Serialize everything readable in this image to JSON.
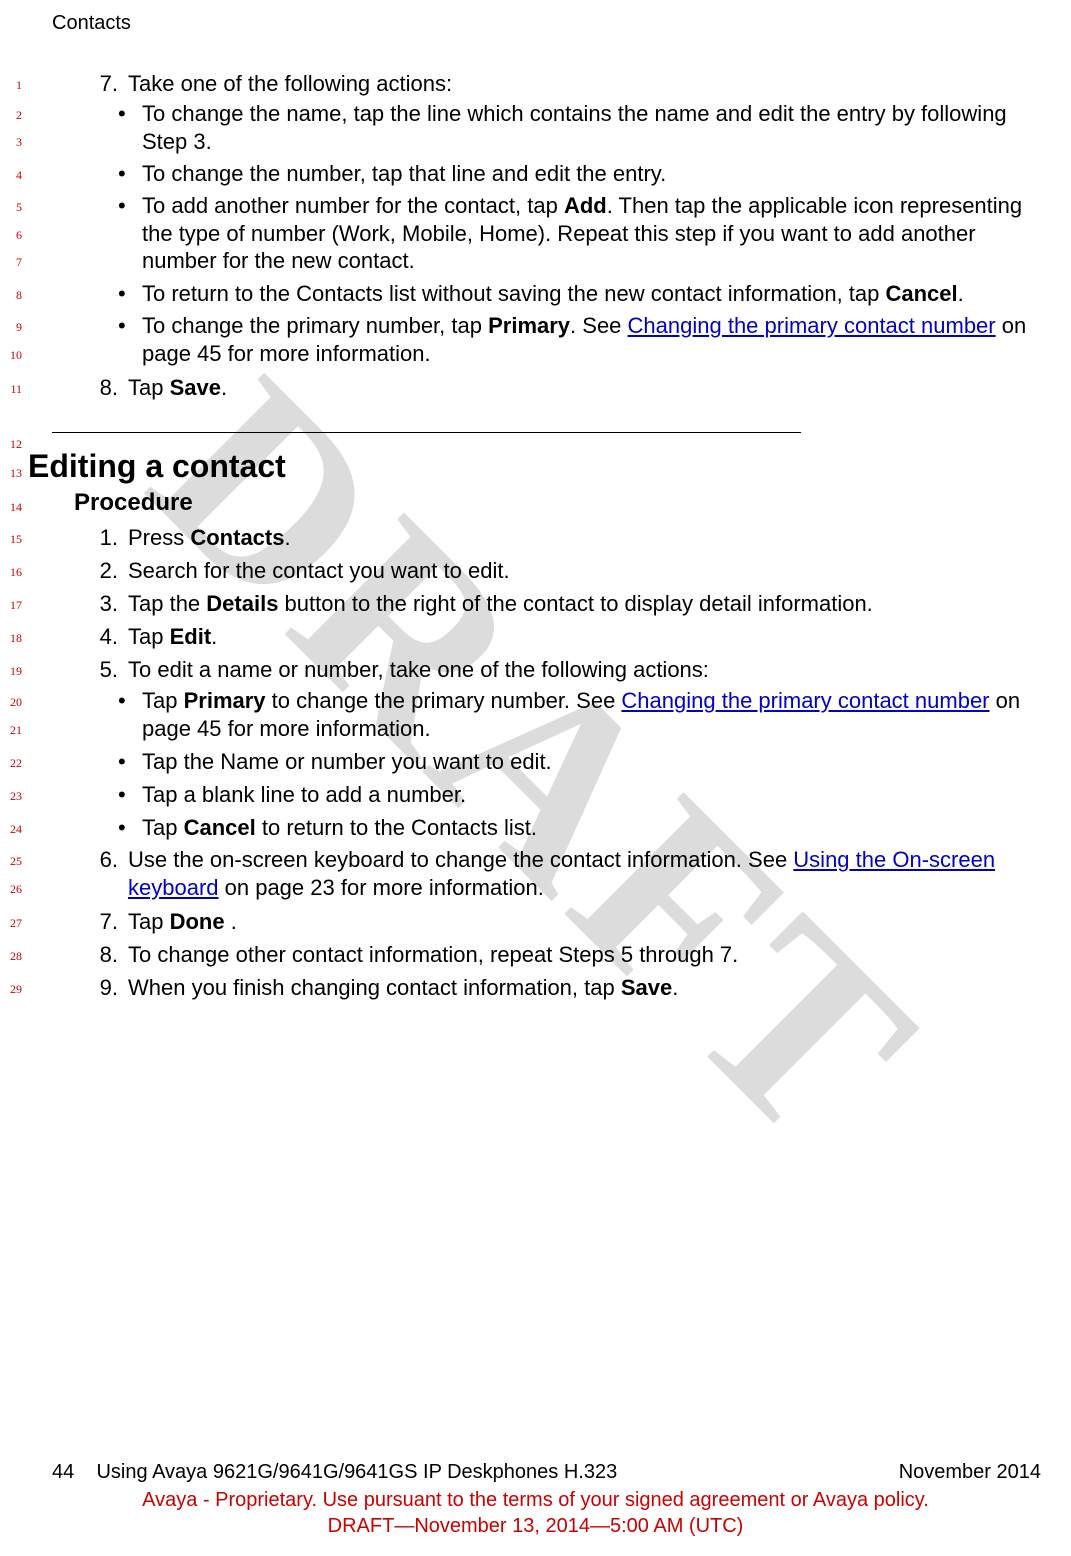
{
  "header": {
    "section": "Contacts"
  },
  "watermark": "DRAFT",
  "line_numbers": {
    "n1": "1",
    "n2": "2",
    "n3": "3",
    "n4": "4",
    "n5": "5",
    "n6": "6",
    "n7": "7",
    "n8": "8",
    "n9": "9",
    "n10": "10",
    "n11": "11",
    "n12": "12",
    "n13": "13",
    "n14": "14",
    "n15": "15",
    "n16": "16",
    "n17": "17",
    "n18": "18",
    "n19": "19",
    "n20": "20",
    "n21": "21",
    "n22": "22",
    "n23": "23",
    "n24": "24",
    "n25": "25",
    "n26": "26",
    "n27": "27",
    "n28": "28",
    "n29": "29"
  },
  "step7": {
    "num": "7.",
    "text": "Take one of the following actions:",
    "b1_pre": "To change the name, tap the line which contains the name and edit the entry by following Step 3.",
    "b2": "To change the number, tap that line and edit the entry.",
    "b3_a": "To add another number for the contact, tap ",
    "b3_bold": "Add",
    "b3_b": ". Then tap the applicable icon representing the type of number (Work, Mobile, Home). Repeat this step if you want to add another number for the new contact.",
    "b4_a": "To return to the Contacts list without saving the new contact information, tap ",
    "b4_bold": "Cancel",
    "b4_b": ".",
    "b5_a": "To change the primary number, tap ",
    "b5_bold": "Primary",
    "b5_b": ". See ",
    "b5_link": "Changing the primary contact number",
    "b5_c": " on page 45 for more information."
  },
  "step8": {
    "num": "8.",
    "a": "Tap ",
    "bold": "Save",
    "b": "."
  },
  "section2": {
    "title": "Editing a contact",
    "subtitle": "Procedure",
    "s1": {
      "num": "1.",
      "a": "Press ",
      "bold": "Contacts",
      "b": "."
    },
    "s2": {
      "num": "2.",
      "text": "Search for the contact you want to edit."
    },
    "s3": {
      "num": "3.",
      "a": "Tap the ",
      "bold": "Details",
      "b": " button to the right of the contact to display detail information."
    },
    "s4": {
      "num": "4.",
      "a": "Tap ",
      "bold": "Edit",
      "b": "."
    },
    "s5": {
      "num": "5.",
      "text": "To edit a name or number, take one of the following actions:",
      "b1_a": "Tap ",
      "b1_bold": "Primary",
      "b1_b": " to change the primary number. See ",
      "b1_link": "Changing the primary contact number",
      "b1_c": " on page 45 for more information.",
      "b2": "Tap the Name or number you want to edit.",
      "b3": "Tap a blank line to add a number.",
      "b4_a": "Tap ",
      "b4_bold": "Cancel",
      "b4_b": " to return to the Contacts list."
    },
    "s6": {
      "num": "6.",
      "a": "Use the on-screen keyboard to change the contact information. See ",
      "link": "Using the On-screen keyboard",
      "b": " on page 23 for more information."
    },
    "s7": {
      "num": "7.",
      "a": "Tap ",
      "bold": "Done",
      "b": " ."
    },
    "s8": {
      "num": "8.",
      "text": "To change other contact information, repeat Steps 5 through 7."
    },
    "s9": {
      "num": "9.",
      "a": "When you finish changing contact information, tap ",
      "bold": "Save",
      "b": "."
    }
  },
  "footer": {
    "page_num": "44",
    "doc_title": "Using Avaya 9621G/9641G/9641GS IP Deskphones H.323",
    "date": "November 2014",
    "prop": "Avaya - Proprietary. Use pursuant to the terms of your signed agreement or Avaya policy.",
    "stamp": "DRAFT—November 13, 2014—5:00 AM (UTC)"
  }
}
